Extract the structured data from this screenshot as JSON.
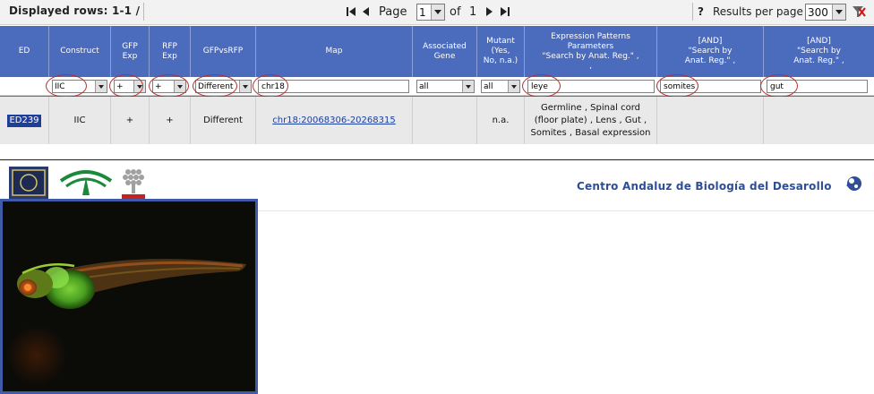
{
  "toolbar": {
    "rows_info": "Displayed rows: 1-1 /",
    "page_label": "Page",
    "page_value": "1",
    "of_label": "of",
    "page_total": "1",
    "help": "?",
    "results_label": "Results per page",
    "results_value": "300"
  },
  "columns": [
    "ED",
    "Construct",
    "GFP\nExp",
    "RFP\nExp",
    "GFPvsRFP",
    "Map",
    "Associated\nGene",
    "Mutant\n(Yes,\nNo, n.a.)",
    "Expression Patterns\nParameters\n\"Search by Anat. Reg.\"  ,\n,",
    "[AND]\n\"Search by\nAnat. Reg.\" ,",
    "[AND]\n\"Search by\nAnat. Reg.\" ,"
  ],
  "filters": {
    "construct": "IIC",
    "gfp": "+",
    "rfp": "+",
    "gfpvsrfp": "Different",
    "map": "chr18",
    "gene": "all",
    "mutant": "all",
    "expr1": "leye",
    "expr2": "somites",
    "expr3": "gut"
  },
  "row": {
    "ed": "ED239",
    "construct": "IIC",
    "gfp": "+",
    "rfp": "+",
    "gfpvsrfp": "Different",
    "map": "chr18:20068306-20268315",
    "gene": "",
    "mutant": "n.a.",
    "expression": "Germline , Spinal cord (floor plate) , Lens , Gut , Somites , Basal expression"
  },
  "banner": {
    "title": "Centro Andaluz de Biología del Desarollo"
  },
  "colors": {
    "header_blue": "#4b6bbd",
    "circle_red": "#b03030",
    "link_blue": "#1a3fa0",
    "photo_border": "#3f5ba8"
  }
}
